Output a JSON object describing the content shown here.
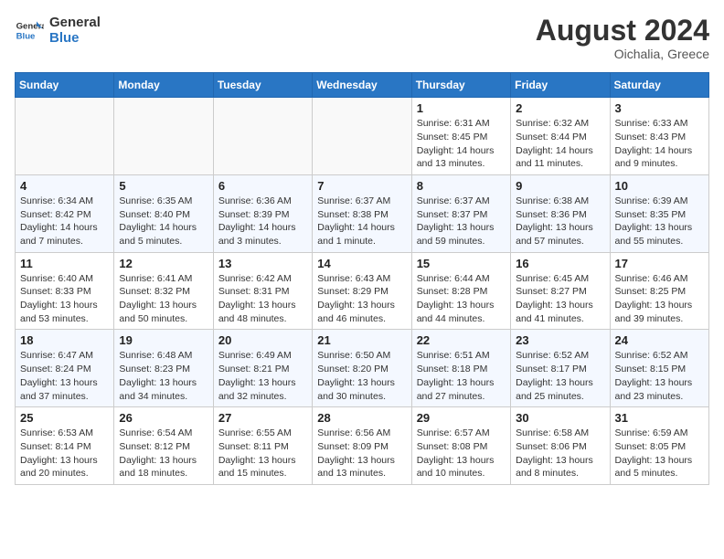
{
  "header": {
    "logo_line1": "General",
    "logo_line2": "Blue",
    "month": "August 2024",
    "location": "Oichalia, Greece"
  },
  "days_of_week": [
    "Sunday",
    "Monday",
    "Tuesday",
    "Wednesday",
    "Thursday",
    "Friday",
    "Saturday"
  ],
  "weeks": [
    [
      {
        "day": "",
        "info": ""
      },
      {
        "day": "",
        "info": ""
      },
      {
        "day": "",
        "info": ""
      },
      {
        "day": "",
        "info": ""
      },
      {
        "day": "1",
        "info": "Sunrise: 6:31 AM\nSunset: 8:45 PM\nDaylight: 14 hours and 13 minutes."
      },
      {
        "day": "2",
        "info": "Sunrise: 6:32 AM\nSunset: 8:44 PM\nDaylight: 14 hours and 11 minutes."
      },
      {
        "day": "3",
        "info": "Sunrise: 6:33 AM\nSunset: 8:43 PM\nDaylight: 14 hours and 9 minutes."
      }
    ],
    [
      {
        "day": "4",
        "info": "Sunrise: 6:34 AM\nSunset: 8:42 PM\nDaylight: 14 hours and 7 minutes."
      },
      {
        "day": "5",
        "info": "Sunrise: 6:35 AM\nSunset: 8:40 PM\nDaylight: 14 hours and 5 minutes."
      },
      {
        "day": "6",
        "info": "Sunrise: 6:36 AM\nSunset: 8:39 PM\nDaylight: 14 hours and 3 minutes."
      },
      {
        "day": "7",
        "info": "Sunrise: 6:37 AM\nSunset: 8:38 PM\nDaylight: 14 hours and 1 minute."
      },
      {
        "day": "8",
        "info": "Sunrise: 6:37 AM\nSunset: 8:37 PM\nDaylight: 13 hours and 59 minutes."
      },
      {
        "day": "9",
        "info": "Sunrise: 6:38 AM\nSunset: 8:36 PM\nDaylight: 13 hours and 57 minutes."
      },
      {
        "day": "10",
        "info": "Sunrise: 6:39 AM\nSunset: 8:35 PM\nDaylight: 13 hours and 55 minutes."
      }
    ],
    [
      {
        "day": "11",
        "info": "Sunrise: 6:40 AM\nSunset: 8:33 PM\nDaylight: 13 hours and 53 minutes."
      },
      {
        "day": "12",
        "info": "Sunrise: 6:41 AM\nSunset: 8:32 PM\nDaylight: 13 hours and 50 minutes."
      },
      {
        "day": "13",
        "info": "Sunrise: 6:42 AM\nSunset: 8:31 PM\nDaylight: 13 hours and 48 minutes."
      },
      {
        "day": "14",
        "info": "Sunrise: 6:43 AM\nSunset: 8:29 PM\nDaylight: 13 hours and 46 minutes."
      },
      {
        "day": "15",
        "info": "Sunrise: 6:44 AM\nSunset: 8:28 PM\nDaylight: 13 hours and 44 minutes."
      },
      {
        "day": "16",
        "info": "Sunrise: 6:45 AM\nSunset: 8:27 PM\nDaylight: 13 hours and 41 minutes."
      },
      {
        "day": "17",
        "info": "Sunrise: 6:46 AM\nSunset: 8:25 PM\nDaylight: 13 hours and 39 minutes."
      }
    ],
    [
      {
        "day": "18",
        "info": "Sunrise: 6:47 AM\nSunset: 8:24 PM\nDaylight: 13 hours and 37 minutes."
      },
      {
        "day": "19",
        "info": "Sunrise: 6:48 AM\nSunset: 8:23 PM\nDaylight: 13 hours and 34 minutes."
      },
      {
        "day": "20",
        "info": "Sunrise: 6:49 AM\nSunset: 8:21 PM\nDaylight: 13 hours and 32 minutes."
      },
      {
        "day": "21",
        "info": "Sunrise: 6:50 AM\nSunset: 8:20 PM\nDaylight: 13 hours and 30 minutes."
      },
      {
        "day": "22",
        "info": "Sunrise: 6:51 AM\nSunset: 8:18 PM\nDaylight: 13 hours and 27 minutes."
      },
      {
        "day": "23",
        "info": "Sunrise: 6:52 AM\nSunset: 8:17 PM\nDaylight: 13 hours and 25 minutes."
      },
      {
        "day": "24",
        "info": "Sunrise: 6:52 AM\nSunset: 8:15 PM\nDaylight: 13 hours and 23 minutes."
      }
    ],
    [
      {
        "day": "25",
        "info": "Sunrise: 6:53 AM\nSunset: 8:14 PM\nDaylight: 13 hours and 20 minutes."
      },
      {
        "day": "26",
        "info": "Sunrise: 6:54 AM\nSunset: 8:12 PM\nDaylight: 13 hours and 18 minutes."
      },
      {
        "day": "27",
        "info": "Sunrise: 6:55 AM\nSunset: 8:11 PM\nDaylight: 13 hours and 15 minutes."
      },
      {
        "day": "28",
        "info": "Sunrise: 6:56 AM\nSunset: 8:09 PM\nDaylight: 13 hours and 13 minutes."
      },
      {
        "day": "29",
        "info": "Sunrise: 6:57 AM\nSunset: 8:08 PM\nDaylight: 13 hours and 10 minutes."
      },
      {
        "day": "30",
        "info": "Sunrise: 6:58 AM\nSunset: 8:06 PM\nDaylight: 13 hours and 8 minutes."
      },
      {
        "day": "31",
        "info": "Sunrise: 6:59 AM\nSunset: 8:05 PM\nDaylight: 13 hours and 5 minutes."
      }
    ]
  ]
}
